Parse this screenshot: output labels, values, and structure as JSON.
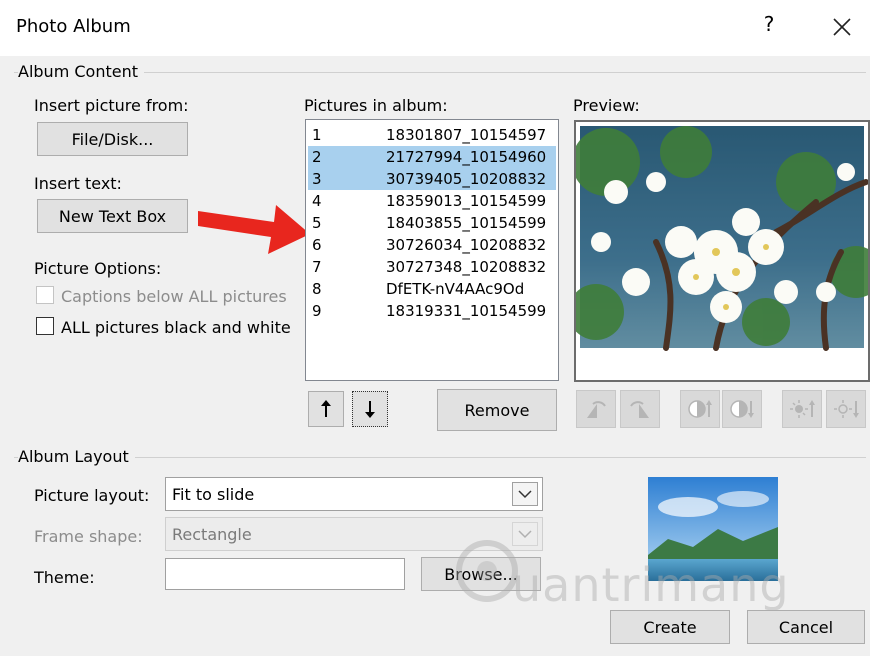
{
  "window": {
    "title": "Photo Album",
    "help_glyph": "?",
    "close_glyph": "✕"
  },
  "album_content": {
    "group_label": "Album Content",
    "insert_picture_label": "Insert picture from:",
    "file_disk_button": "File/Disk...",
    "insert_text_label": "Insert text:",
    "new_text_box_button": "New Text Box",
    "picture_options_label": "Picture Options:",
    "captions_checkbox": {
      "label": "Captions below ALL pictures",
      "checked": false,
      "enabled": false
    },
    "black_white_checkbox": {
      "label": "ALL pictures black and white",
      "checked": false,
      "enabled": true
    },
    "pictures_label": "Pictures in album:",
    "pictures": [
      {
        "num": "1",
        "name": "18301807_10154597",
        "selected": false
      },
      {
        "num": "2",
        "name": "21727994_10154960",
        "selected": true
      },
      {
        "num": "3",
        "name": "30739405_10208832",
        "selected": true
      },
      {
        "num": "4",
        "name": "18359013_10154599",
        "selected": false
      },
      {
        "num": "5",
        "name": "18403855_10154599",
        "selected": false
      },
      {
        "num": "6",
        "name": "30726034_10208832",
        "selected": false
      },
      {
        "num": "7",
        "name": "30727348_10208832",
        "selected": false
      },
      {
        "num": "8",
        "name": "DfETK-nV4AAc9Od",
        "selected": false
      },
      {
        "num": "9",
        "name": "18319331_10154599",
        "selected": false
      }
    ],
    "move_up_glyph": "🠕",
    "move_down_glyph": "🠗",
    "remove_button": "Remove",
    "preview_label": "Preview:"
  },
  "album_layout": {
    "group_label": "Album Layout",
    "picture_layout_label": "Picture layout:",
    "picture_layout_value": "Fit to slide",
    "frame_shape_label": "Frame shape:",
    "frame_shape_value": "Rectangle",
    "theme_label": "Theme:",
    "theme_value": "",
    "browse_button": "Browse..."
  },
  "footer": {
    "create_button": "Create",
    "cancel_button": "Cancel"
  },
  "watermark": {
    "text": "uantrimang"
  },
  "annotation": {
    "arrow_color": "#e8261e"
  },
  "colors": {
    "selection": "#a8d0ee",
    "dialog_bg": "#f0f0f0"
  }
}
